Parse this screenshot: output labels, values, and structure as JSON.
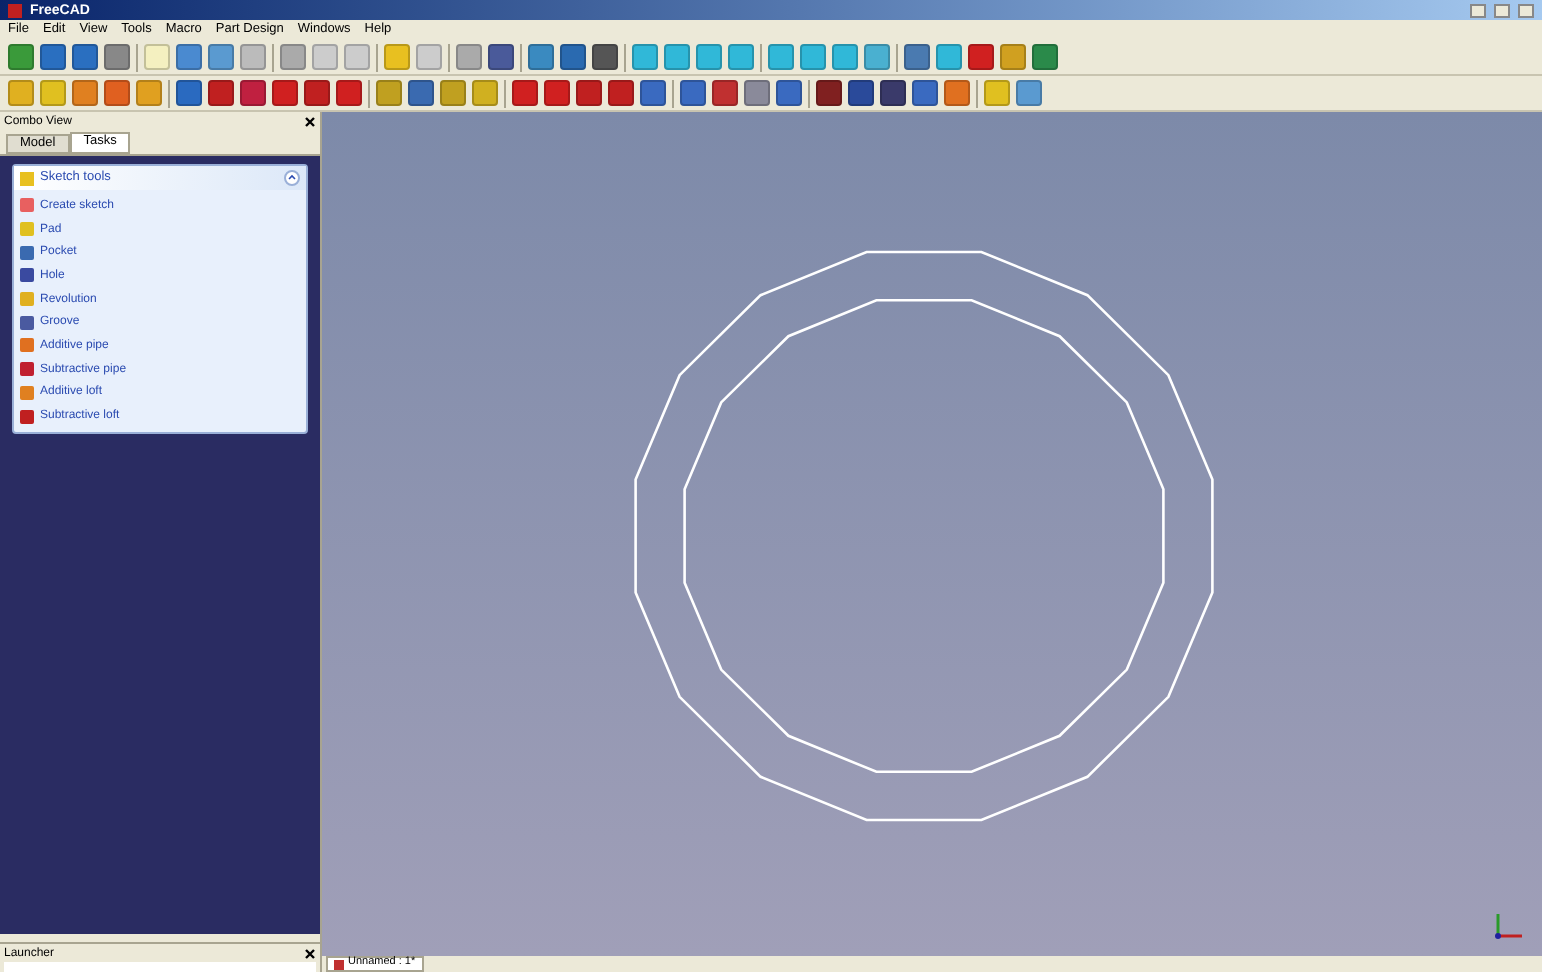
{
  "window": {
    "title": "FreeCAD"
  },
  "menu": [
    "File",
    "Edit",
    "View",
    "Tools",
    "Macro",
    "Part Design",
    "Windows",
    "Help"
  ],
  "combo_view": {
    "title": "Combo View",
    "tabs": [
      {
        "label": "Model",
        "selected": false
      },
      {
        "label": "Tasks",
        "selected": true
      }
    ],
    "task_panel": {
      "title": "Sketch tools",
      "expanded": true,
      "items": [
        "Create sketch",
        "Pad",
        "Pocket",
        "Hole",
        "Revolution",
        "Groove",
        "Additive pipe",
        "Subtractive pipe",
        "Additive loft",
        "Subtractive loft"
      ]
    }
  },
  "launcher": {
    "title": "Launcher"
  },
  "document_tab": {
    "label": "Unnamed : 1*"
  }
}
